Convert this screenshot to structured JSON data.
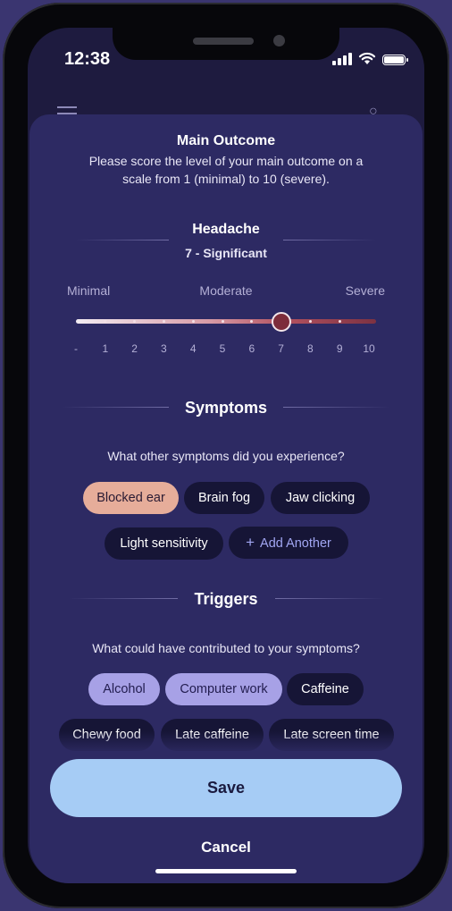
{
  "status_bar": {
    "time": "12:38"
  },
  "main_outcome": {
    "title": "Main Outcome",
    "description_line1": "Please score the level of your main outcome on a",
    "description_line2": "scale from 1 (minimal) to 10 (severe).",
    "condition": "Headache",
    "score_text": "7 - Significant",
    "scale_labels": {
      "min": "Minimal",
      "mid": "Moderate",
      "max": "Severe"
    },
    "ticks": [
      "-",
      "1",
      "2",
      "3",
      "4",
      "5",
      "6",
      "7",
      "8",
      "9",
      "10"
    ],
    "selected_value": 7,
    "accent_color": "#7d2d3b"
  },
  "symptoms": {
    "title": "Symptoms",
    "question": "What other symptoms did you experience?",
    "chips": [
      {
        "label": "Blocked ear",
        "selected": true
      },
      {
        "label": "Brain fog",
        "selected": false
      },
      {
        "label": "Jaw clicking",
        "selected": false
      },
      {
        "label": "Light sensitivity",
        "selected": false
      }
    ],
    "add_label": "Add Another",
    "selected_color": "#e6ad9a"
  },
  "triggers": {
    "title": "Triggers",
    "question": "What could have contributed to your symptoms?",
    "chips": [
      {
        "label": "Alcohol",
        "selected": true
      },
      {
        "label": "Computer work",
        "selected": true
      },
      {
        "label": "Caffeine",
        "selected": false
      },
      {
        "label": "Chewy food",
        "selected": false
      },
      {
        "label": "Late caffeine",
        "selected": false
      },
      {
        "label": "Late screen time",
        "selected": false
      }
    ],
    "selected_color": "#a7a1e6"
  },
  "actions": {
    "save_label": "Save",
    "cancel_label": "Cancel",
    "save_color": "#a6ccf5"
  },
  "icons": {
    "menu": "hamburger-icon",
    "bell": "bell-icon",
    "add": "plus-icon",
    "signal": "signal-icon",
    "wifi": "wifi-icon",
    "battery": "battery-icon"
  }
}
